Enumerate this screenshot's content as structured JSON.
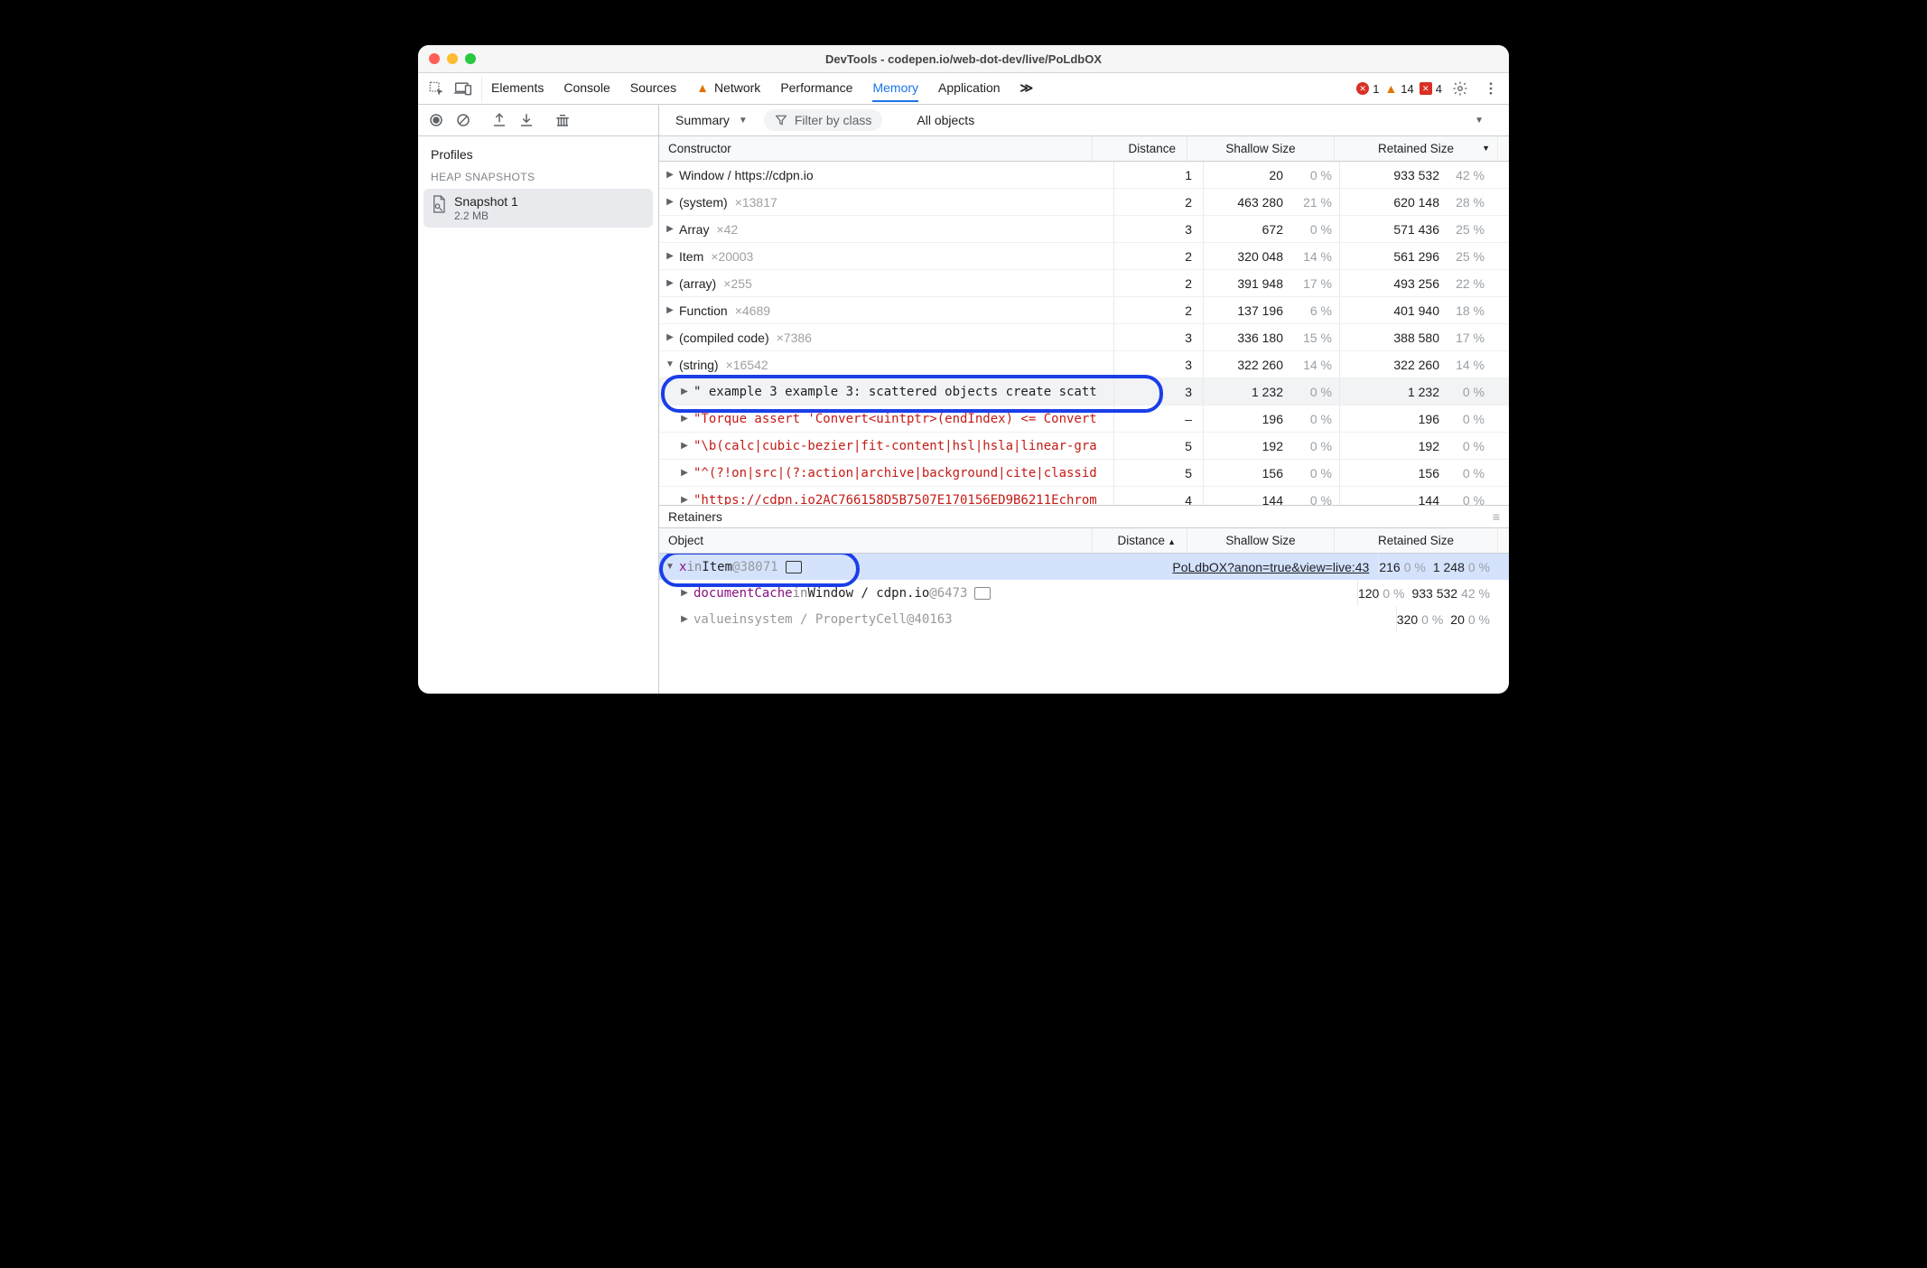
{
  "window_title": "DevTools - codepen.io/web-dot-dev/live/PoLdbOX",
  "panel_tabs": [
    "Elements",
    "Console",
    "Sources",
    "Network",
    "Performance",
    "Memory",
    "Application"
  ],
  "active_panel": "Memory",
  "more_tabs_glyph": "≫",
  "status": {
    "errors": "1",
    "warnings": "14",
    "ext": "4"
  },
  "profiles_label": "Profiles",
  "heap_section": "HEAP SNAPSHOTS",
  "snapshot": {
    "name": "Snapshot 1",
    "size": "2.2 MB"
  },
  "summary_dropdown": "Summary",
  "filter_placeholder": "Filter by class",
  "objects_dropdown": "All objects",
  "headers": {
    "constructor": "Constructor",
    "distance": "Distance",
    "shallow": "Shallow Size",
    "retained": "Retained Size",
    "object": "Object"
  },
  "rows": [
    {
      "expanded": false,
      "indent": 0,
      "name": "Window / https://cdpn.io",
      "count": null,
      "mono": false,
      "d": "1",
      "sVal": "20",
      "sPct": "0 %",
      "rVal": "933 532",
      "rPct": "42 %"
    },
    {
      "expanded": false,
      "indent": 0,
      "name": "(system)",
      "count": "×13817",
      "mono": false,
      "d": "2",
      "sVal": "463 280",
      "sPct": "21 %",
      "rVal": "620 148",
      "rPct": "28 %"
    },
    {
      "expanded": false,
      "indent": 0,
      "name": "Array",
      "count": "×42",
      "mono": false,
      "d": "3",
      "sVal": "672",
      "sPct": "0 %",
      "rVal": "571 436",
      "rPct": "25 %"
    },
    {
      "expanded": false,
      "indent": 0,
      "name": "Item",
      "count": "×20003",
      "mono": false,
      "d": "2",
      "sVal": "320 048",
      "sPct": "14 %",
      "rVal": "561 296",
      "rPct": "25 %"
    },
    {
      "expanded": false,
      "indent": 0,
      "name": "(array)",
      "count": "×255",
      "mono": false,
      "d": "2",
      "sVal": "391 948",
      "sPct": "17 %",
      "rVal": "493 256",
      "rPct": "22 %"
    },
    {
      "expanded": false,
      "indent": 0,
      "name": "Function",
      "count": "×4689",
      "mono": false,
      "d": "2",
      "sVal": "137 196",
      "sPct": "6 %",
      "rVal": "401 940",
      "rPct": "18 %"
    },
    {
      "expanded": false,
      "indent": 0,
      "name": "(compiled code)",
      "count": "×7386",
      "mono": false,
      "d": "3",
      "sVal": "336 180",
      "sPct": "15 %",
      "rVal": "388 580",
      "rPct": "17 %"
    },
    {
      "expanded": true,
      "indent": 0,
      "name": "(string)",
      "count": "×16542",
      "mono": false,
      "d": "3",
      "sVal": "322 260",
      "sPct": "14 %",
      "rVal": "322 260",
      "rPct": "14 %"
    },
    {
      "expanded": false,
      "indent": 1,
      "name": "\" example 3 example 3: scattered objects create scatt",
      "count": null,
      "mono": true,
      "d": "3",
      "sVal": "1 232",
      "sPct": "0 %",
      "rVal": "1 232",
      "rPct": "0 %",
      "selected": true,
      "ring": true
    },
    {
      "expanded": false,
      "indent": 1,
      "name": "\"Torque assert 'Convert<uintptr>(endIndex) <= Convert",
      "count": null,
      "mono": true,
      "red": true,
      "d": "–",
      "sVal": "196",
      "sPct": "0 %",
      "rVal": "196",
      "rPct": "0 %"
    },
    {
      "expanded": false,
      "indent": 1,
      "name": "\"\\b(calc|cubic-bezier|fit-content|hsl|hsla|linear-gra",
      "count": null,
      "mono": true,
      "red": true,
      "d": "5",
      "sVal": "192",
      "sPct": "0 %",
      "rVal": "192",
      "rPct": "0 %"
    },
    {
      "expanded": false,
      "indent": 1,
      "name": "\"^(?!on|src|(?:action|archive|background|cite|classid",
      "count": null,
      "mono": true,
      "red": true,
      "d": "5",
      "sVal": "156",
      "sPct": "0 %",
      "rVal": "156",
      "rPct": "0 %"
    },
    {
      "expanded": false,
      "indent": 1,
      "name": "\"https://cdpn.io2AC766158D5B7507E170156ED9B6211Echrom",
      "count": null,
      "mono": true,
      "red": true,
      "d": "4",
      "sVal": "144",
      "sPct": "0 %",
      "rVal": "144",
      "rPct": "0 %"
    }
  ],
  "retainers_label": "Retainers",
  "retainer_rows": [
    {
      "expanded": true,
      "hl": true,
      "ring": true,
      "var": "x",
      "inword": "in",
      "cls": "Item",
      "atid": "@38071",
      "chip": "dark",
      "link": "PoLdbOX?anon=true&view=live:43",
      "d": "2",
      "sVal": "16",
      "sPct": "0 %",
      "rVal": "1 248",
      "rPct": "0 %"
    },
    {
      "expanded": false,
      "indent": 1,
      "var": "documentCache",
      "inword": "in",
      "cls": "Window / cdpn.io",
      "atid": "@6473",
      "chip": "light",
      "d": "1",
      "sVal": "20",
      "sPct": "0 %",
      "rVal": "933 532",
      "rPct": "42 %"
    },
    {
      "expanded": false,
      "indent": 1,
      "dim": true,
      "var": "value",
      "inword": "in",
      "cls": "system / PropertyCell",
      "atid": "@40163",
      "d": "3",
      "sVal": "20",
      "sPct": "0 %",
      "rVal": "20",
      "rPct": "0 %"
    }
  ]
}
